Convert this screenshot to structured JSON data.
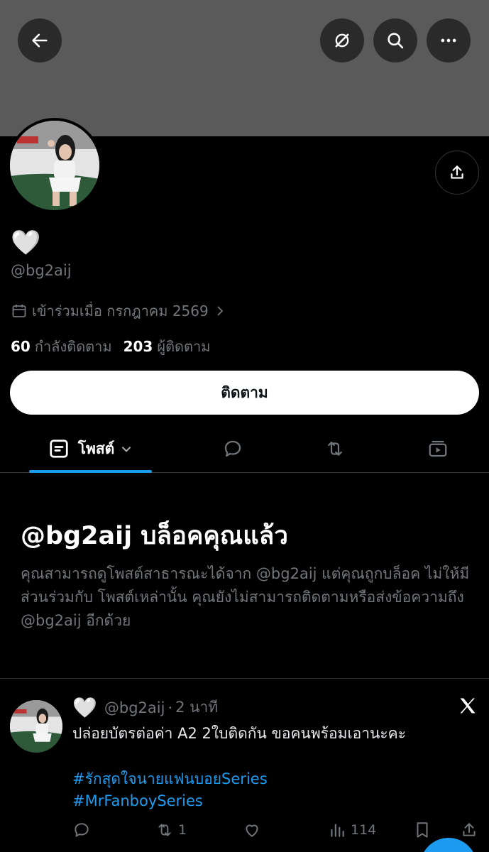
{
  "profile": {
    "display_name": "🤍",
    "handle": "@bg2aij",
    "joined": "เข้าร่วมเมื่อ กรกฎาคม 2569",
    "following_count": "60",
    "following_label": "กำลังติดตาม",
    "followers_count": "203",
    "followers_label": "ผู้ติดตาม",
    "follow_button": "ติดตาม"
  },
  "tabs": {
    "posts_label": "โพสต์"
  },
  "blocked": {
    "title": "@bg2aij บล็อคคุณแล้ว",
    "body": "คุณสามารถดูโพสต์สาธารณะได้จาก @bg2aij แต่คุณถูกบล็อค ไม่ให้มีส่วนร่วมกับ โพสต์เหล่านั้น คุณยังไม่สามารถติดตามหรือส่งข้อความถึง @bg2aij อีกด้วย"
  },
  "tweet": {
    "name": "🤍",
    "handle": "@bg2aij",
    "separator": "·",
    "time": "2 นาที",
    "text": "ปล่อยบัตรต่อค่า A2 2ใบติดกัน ขอคนพร้อมเอานะคะ",
    "hashtag1": "#รักสุดใจนายแฟนบอยSeries",
    "hashtag2": "#MrFanboySeries",
    "repost_count": "1",
    "view_count": "114"
  },
  "colors": {
    "accent": "#1d9bf0",
    "banner": "#5a5a5a",
    "background": "#000000",
    "secondary_text": "#71767b"
  },
  "icons": [
    "back-arrow-icon",
    "grok-icon",
    "search-icon",
    "more-icon",
    "share-icon",
    "calendar-icon",
    "chevron-right-icon",
    "posts-icon",
    "chevron-down-icon",
    "reply-icon",
    "repost-icon",
    "media-icon",
    "x-logo-icon",
    "like-icon",
    "views-icon",
    "bookmark-icon"
  ]
}
